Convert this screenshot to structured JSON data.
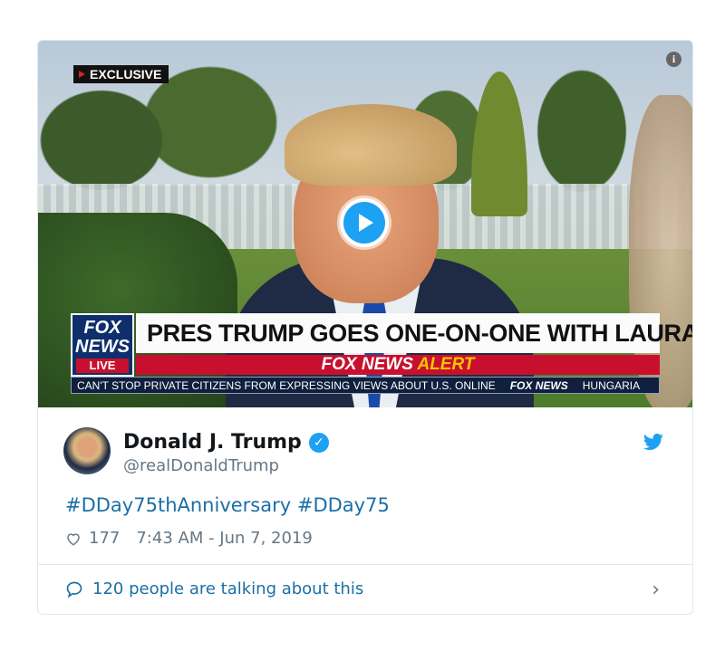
{
  "video": {
    "badge": "EXCLUSIVE",
    "info_icon": "i",
    "lower_third": {
      "logo_line1": "FOX",
      "logo_line2": "NEWS",
      "logo_line3": "LIVE",
      "headline": "PRES TRUMP GOES ONE-ON-ONE WITH LAURA",
      "alert_white": "FOX NEWS",
      "alert_yellow": "ALERT",
      "ticker_text": "CAN'T STOP PRIVATE CITIZENS FROM EXPRESSING VIEWS ABOUT U.S. ONLINE",
      "ticker_brand": "FOX NEWS",
      "ticker_next": "HUNGARIA"
    }
  },
  "tweet": {
    "author_name": "Donald J. Trump",
    "author_handle": "@realDonaldTrump",
    "text": "#DDay75thAnniversary #DDay75",
    "likes": "177",
    "timestamp": "7:43 AM - Jun 7, 2019",
    "talking": "120 people are talking about this"
  },
  "colors": {
    "link": "#1b6fa6",
    "twitter_blue": "#1da1f2",
    "muted": "#657786"
  }
}
